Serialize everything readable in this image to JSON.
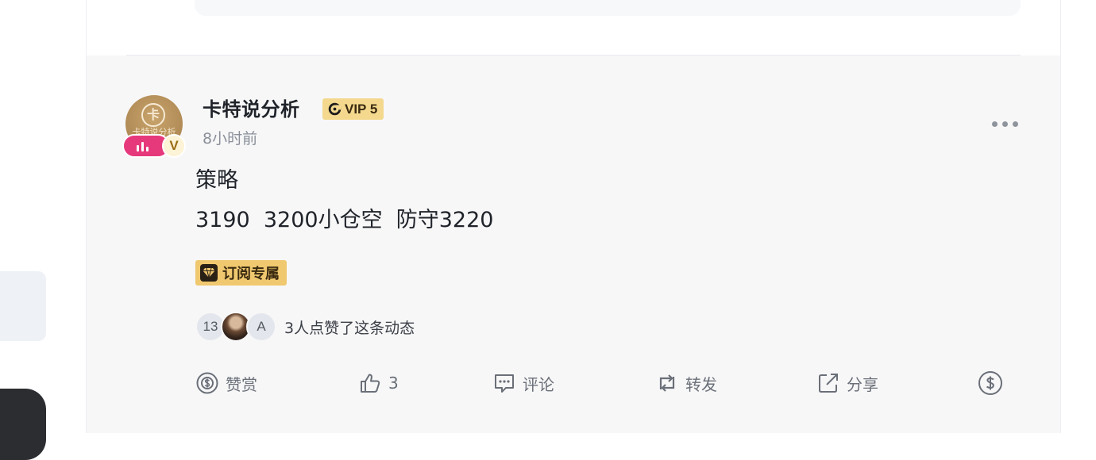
{
  "post": {
    "author": {
      "name": "卡特说分析",
      "vip_label": "VIP 5",
      "avatar_glyph": "卡",
      "avatar_sub": "卡特说分析",
      "verified_letter": "V"
    },
    "time": "8小时前",
    "title": "策略",
    "body": "3190  3200小仓空  防守3220",
    "subscription_badge": "订阅专属",
    "likes": {
      "count_avatar": "13",
      "letter_avatar": "A",
      "text": "3人点赞了这条动态"
    },
    "actions": {
      "tip_label": "赞赏",
      "like_count": "3",
      "comment_label": "评论",
      "repost_label": "转发",
      "share_label": "分享"
    }
  },
  "colors": {
    "vip_badge": "#f3d88e",
    "subscription_badge": "#f0c86f",
    "live_pill": "#e6397b",
    "post_background": "#f7f7f8"
  }
}
